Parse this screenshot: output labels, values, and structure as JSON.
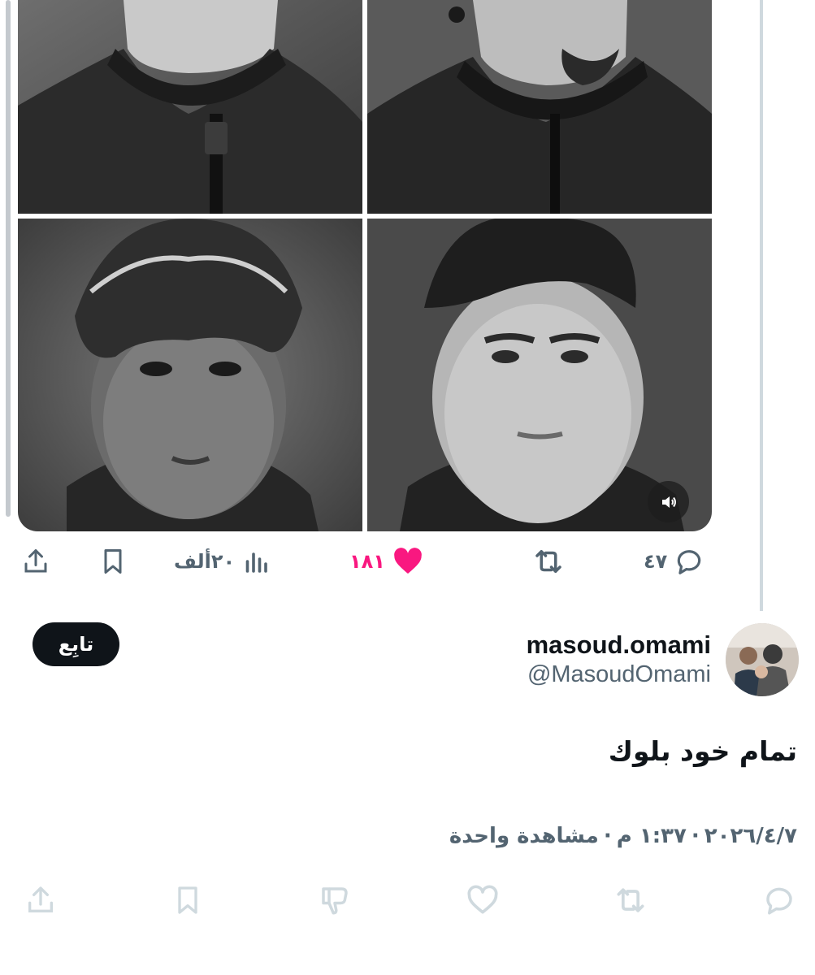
{
  "media": {
    "photos": [
      {
        "alt": "player-top-left"
      },
      {
        "alt": "player-top-right"
      },
      {
        "alt": "player-bottom-left"
      },
      {
        "alt": "player-bottom-right"
      }
    ],
    "volume_icon": "speaker-icon"
  },
  "parent_actions": {
    "replies": "٤٧",
    "likes": "١٨١",
    "views": "٢٠ألف"
  },
  "author": {
    "display_name": "masoud.omami",
    "handle": "@MasoudOmami",
    "follow_label": "تابِع"
  },
  "tweet": {
    "text": "تمام خود بلوك",
    "date": "٢٠٢٦/٤/٧",
    "time": "١:٣٧ م",
    "separator": "·",
    "views": "مشاهدة واحدة"
  },
  "colors": {
    "like": "#f91880",
    "muted": "#536471",
    "text": "#0f1419",
    "follow_bg": "#0f1419"
  },
  "icons": [
    "reply-icon",
    "retweet-icon",
    "heart-icon",
    "views-icon",
    "bookmark-icon",
    "share-icon",
    "dislike-icon"
  ]
}
